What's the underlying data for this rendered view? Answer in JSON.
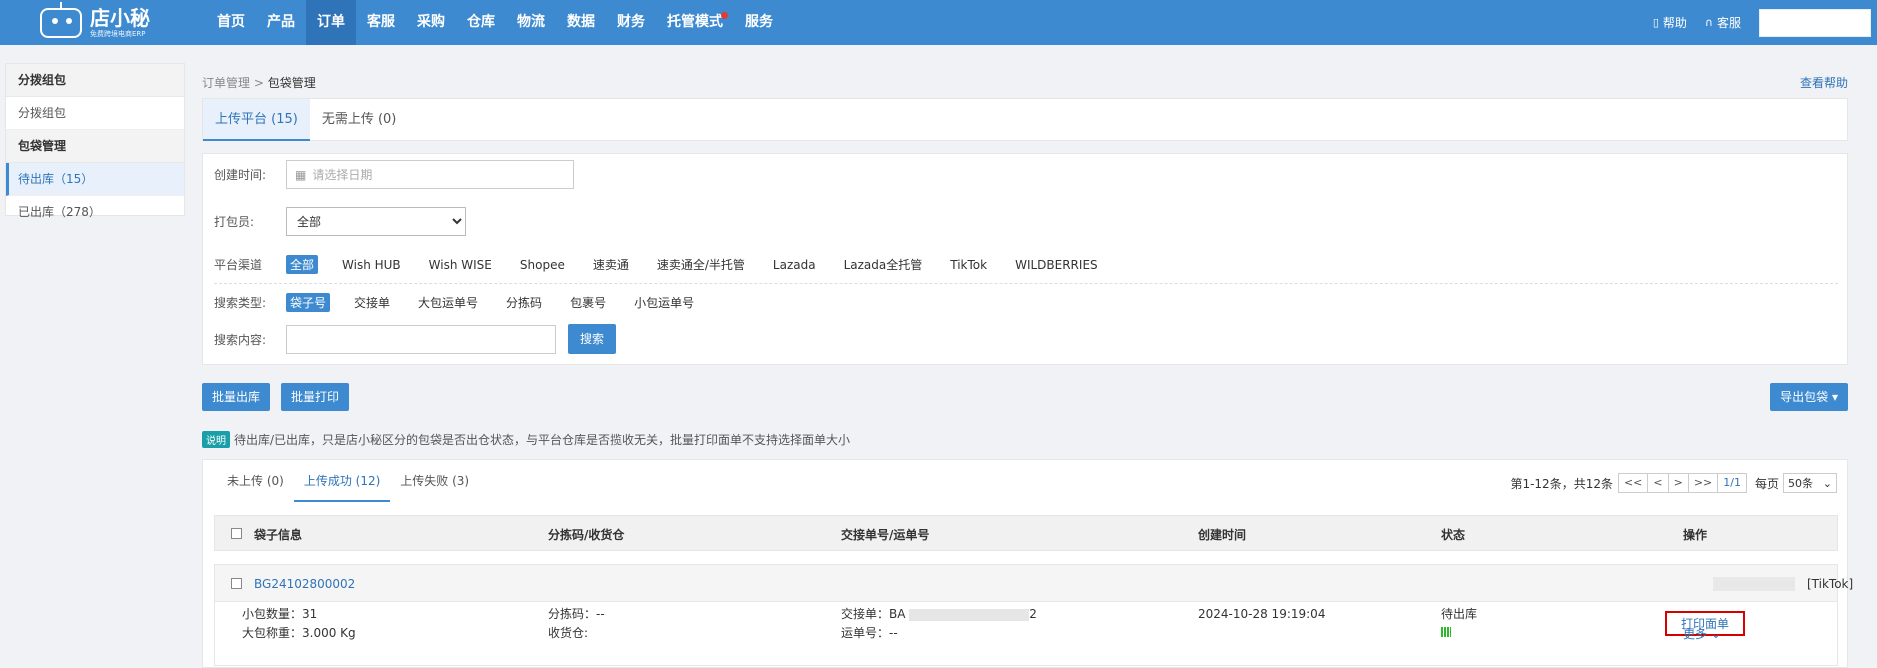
{
  "header": {
    "logo_title": "店小秘",
    "logo_sub": "免费跨境电商ERP",
    "nav": [
      {
        "label": "首页",
        "active": false
      },
      {
        "label": "产品",
        "active": false
      },
      {
        "label": "订单",
        "active": true
      },
      {
        "label": "客服",
        "active": false
      },
      {
        "label": "采购",
        "active": false
      },
      {
        "label": "仓库",
        "active": false
      },
      {
        "label": "物流",
        "active": false
      },
      {
        "label": "数据",
        "active": false
      },
      {
        "label": "财务",
        "active": false
      },
      {
        "label": "托管模式",
        "active": false,
        "dot": true
      },
      {
        "label": "服务",
        "active": false
      }
    ],
    "help": "帮助",
    "service": "客服"
  },
  "sidebar": {
    "group1": "分拨组包",
    "item1": "分拨组包",
    "group2": "包袋管理",
    "item_pending": "待出库（15）",
    "item_shipped": "已出库（278）"
  },
  "breadcrumb": {
    "parent": "订单管理",
    "sep": ">",
    "current": "包袋管理"
  },
  "help_link": "查看帮助",
  "top_tabs": [
    "上传平台 (15)",
    "无需上传 (0)"
  ],
  "filter": {
    "created_label": "创建时间:",
    "date_placeholder": "请选择日期",
    "packer_label": "打包员:",
    "packer_value": "全部",
    "platform_label": "平台渠道",
    "platforms": [
      "全部",
      "Wish HUB",
      "Wish WISE",
      "Shopee",
      "速卖通",
      "速卖通全/半托管",
      "Lazada",
      "Lazada全托管",
      "TikTok",
      "WILDBERRIES"
    ],
    "search_type_label": "搜索类型:",
    "search_types": [
      "袋子号",
      "交接单",
      "大包运单号",
      "分拣码",
      "包裹号",
      "小包运单号"
    ],
    "search_content_label": "搜索内容:",
    "search_button": "搜索"
  },
  "actions": {
    "batch_out": "批量出库",
    "batch_print": "批量打印",
    "export": "导出包袋"
  },
  "note": {
    "badge": "说明",
    "text": "待出库/已出库，只是店小秘区分的包袋是否出仓状态，与平台仓库是否揽收无关，批量打印面单不支持选择面单大小"
  },
  "sub_tabs": [
    "未上传 (0)",
    "上传成功 (12)",
    "上传失败 (3)"
  ],
  "pager": {
    "info": "第1-12条，共12条",
    "first": "<<",
    "prev": "<",
    "next": ">",
    "last": ">>",
    "page": "1/1",
    "per_page_label": "每页",
    "per_page": "50条"
  },
  "table": {
    "headers": [
      "袋子信息",
      "分拣码/收货仓",
      "交接单号/运单号",
      "创建时间",
      "状态",
      "操作"
    ],
    "row": {
      "bag_no": "BG24102800002",
      "platform": "[TikTok]",
      "small_count": "小包数量：31",
      "weight": "大包称重：3.000 Kg",
      "sort_code": "分拣码：--",
      "warehouse": "收货仓:",
      "handover_label": "交接单：",
      "handover_prefix": "BA",
      "handover_suffix": "2",
      "waybill": "运单号：--",
      "created": "2024-10-28 19:19:04",
      "status": "待出库",
      "print": "打印面单",
      "more": "更多"
    }
  }
}
